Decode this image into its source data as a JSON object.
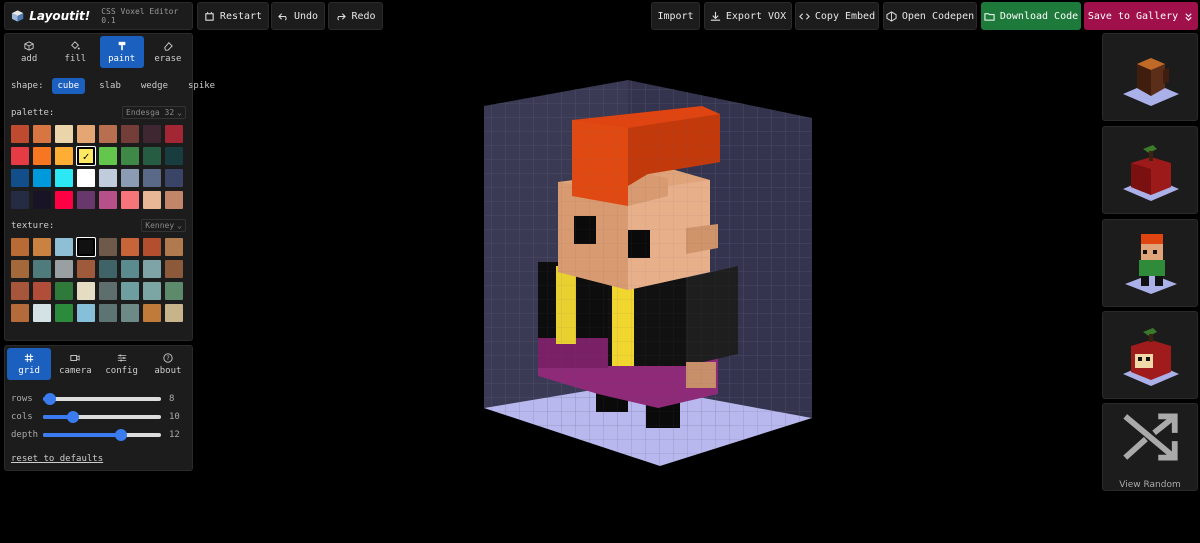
{
  "app": {
    "name": "Layoutit!",
    "version": "CSS Voxel Editor 0.1"
  },
  "toolbar": {
    "restart": "Restart",
    "undo": "Undo",
    "redo": "Redo",
    "import": "Import",
    "export_vox": "Export VOX",
    "copy_embed": "Copy Embed",
    "open_codepen": "Open Codepen",
    "download_code": "Download Code",
    "save_gallery": "Save to Gallery"
  },
  "tools": [
    {
      "label": "add",
      "icon": "cube-icon"
    },
    {
      "label": "fill",
      "icon": "paint-bucket-icon"
    },
    {
      "label": "paint",
      "icon": "paint-roller-icon",
      "active": true
    },
    {
      "label": "erase",
      "icon": "eraser-icon"
    }
  ],
  "shape": {
    "label": "shape:",
    "options": [
      "cube",
      "slab",
      "wedge",
      "spike"
    ],
    "selected": "cube"
  },
  "palette": {
    "label": "palette:",
    "selected_set": "Endesga 32",
    "colors": [
      "#be4a2f",
      "#d77643",
      "#ead4aa",
      "#e4a672",
      "#b86f50",
      "#733e39",
      "#3e2731",
      "#a22633",
      "#e43b44",
      "#f77622",
      "#feae34",
      "#fee761",
      "#63c74d",
      "#3e8948",
      "#265c42",
      "#193c3e",
      "#124e89",
      "#0099db",
      "#2ce8f5",
      "#ffffff",
      "#c0cbdc",
      "#8b9bb4",
      "#5a6988",
      "#3a4466",
      "#262b44",
      "#181425",
      "#ff0044",
      "#68386c",
      "#b55088",
      "#f6757a",
      "#e8b796",
      "#c28569"
    ],
    "selected_index": 11
  },
  "texture": {
    "label": "texture:",
    "selected_set": "Kenney",
    "swatches": [
      "#b86b35",
      "#c9823f",
      "#8fbfd4",
      "#111111",
      "#6d5a4a",
      "#c8643a",
      "#b34e2e",
      "#b07a4e",
      "#a3693b",
      "#4f7b7c",
      "#9aa0a2",
      "#9e5a3a",
      "#3f6367",
      "#5b8b8e",
      "#7fa4a8",
      "#8c5a3a",
      "#a6563a",
      "#b04e3a",
      "#2f7a3a",
      "#e5dcc4",
      "#5e6e6c",
      "#6e9ea0",
      "#7ca6a4",
      "#5d8a6a",
      "#b56a3a",
      "#d4e2e6",
      "#2c8a3d",
      "#86c0d8",
      "#5c7574",
      "#6e8a86",
      "#c07a3a",
      "#c8b48a"
    ],
    "selected_index": 3
  },
  "panel_tabs": [
    {
      "label": "grid",
      "icon": "grid-icon",
      "active": true
    },
    {
      "label": "camera",
      "icon": "camera-icon"
    },
    {
      "label": "config",
      "icon": "sliders-icon"
    },
    {
      "label": "about",
      "icon": "help-icon"
    }
  ],
  "sliders": [
    {
      "label": "rows",
      "value": "8",
      "level": 0.06
    },
    {
      "label": "cols",
      "value": "10",
      "level": 0.25
    },
    {
      "label": "depth",
      "value": "12",
      "level": 0.66
    }
  ],
  "reset_label": "reset to defaults",
  "gallery": {
    "view_random": "View Random"
  },
  "colors": {
    "accent": "#1b5fbf",
    "download": "#1e7a3a",
    "save": "#a0104a"
  }
}
